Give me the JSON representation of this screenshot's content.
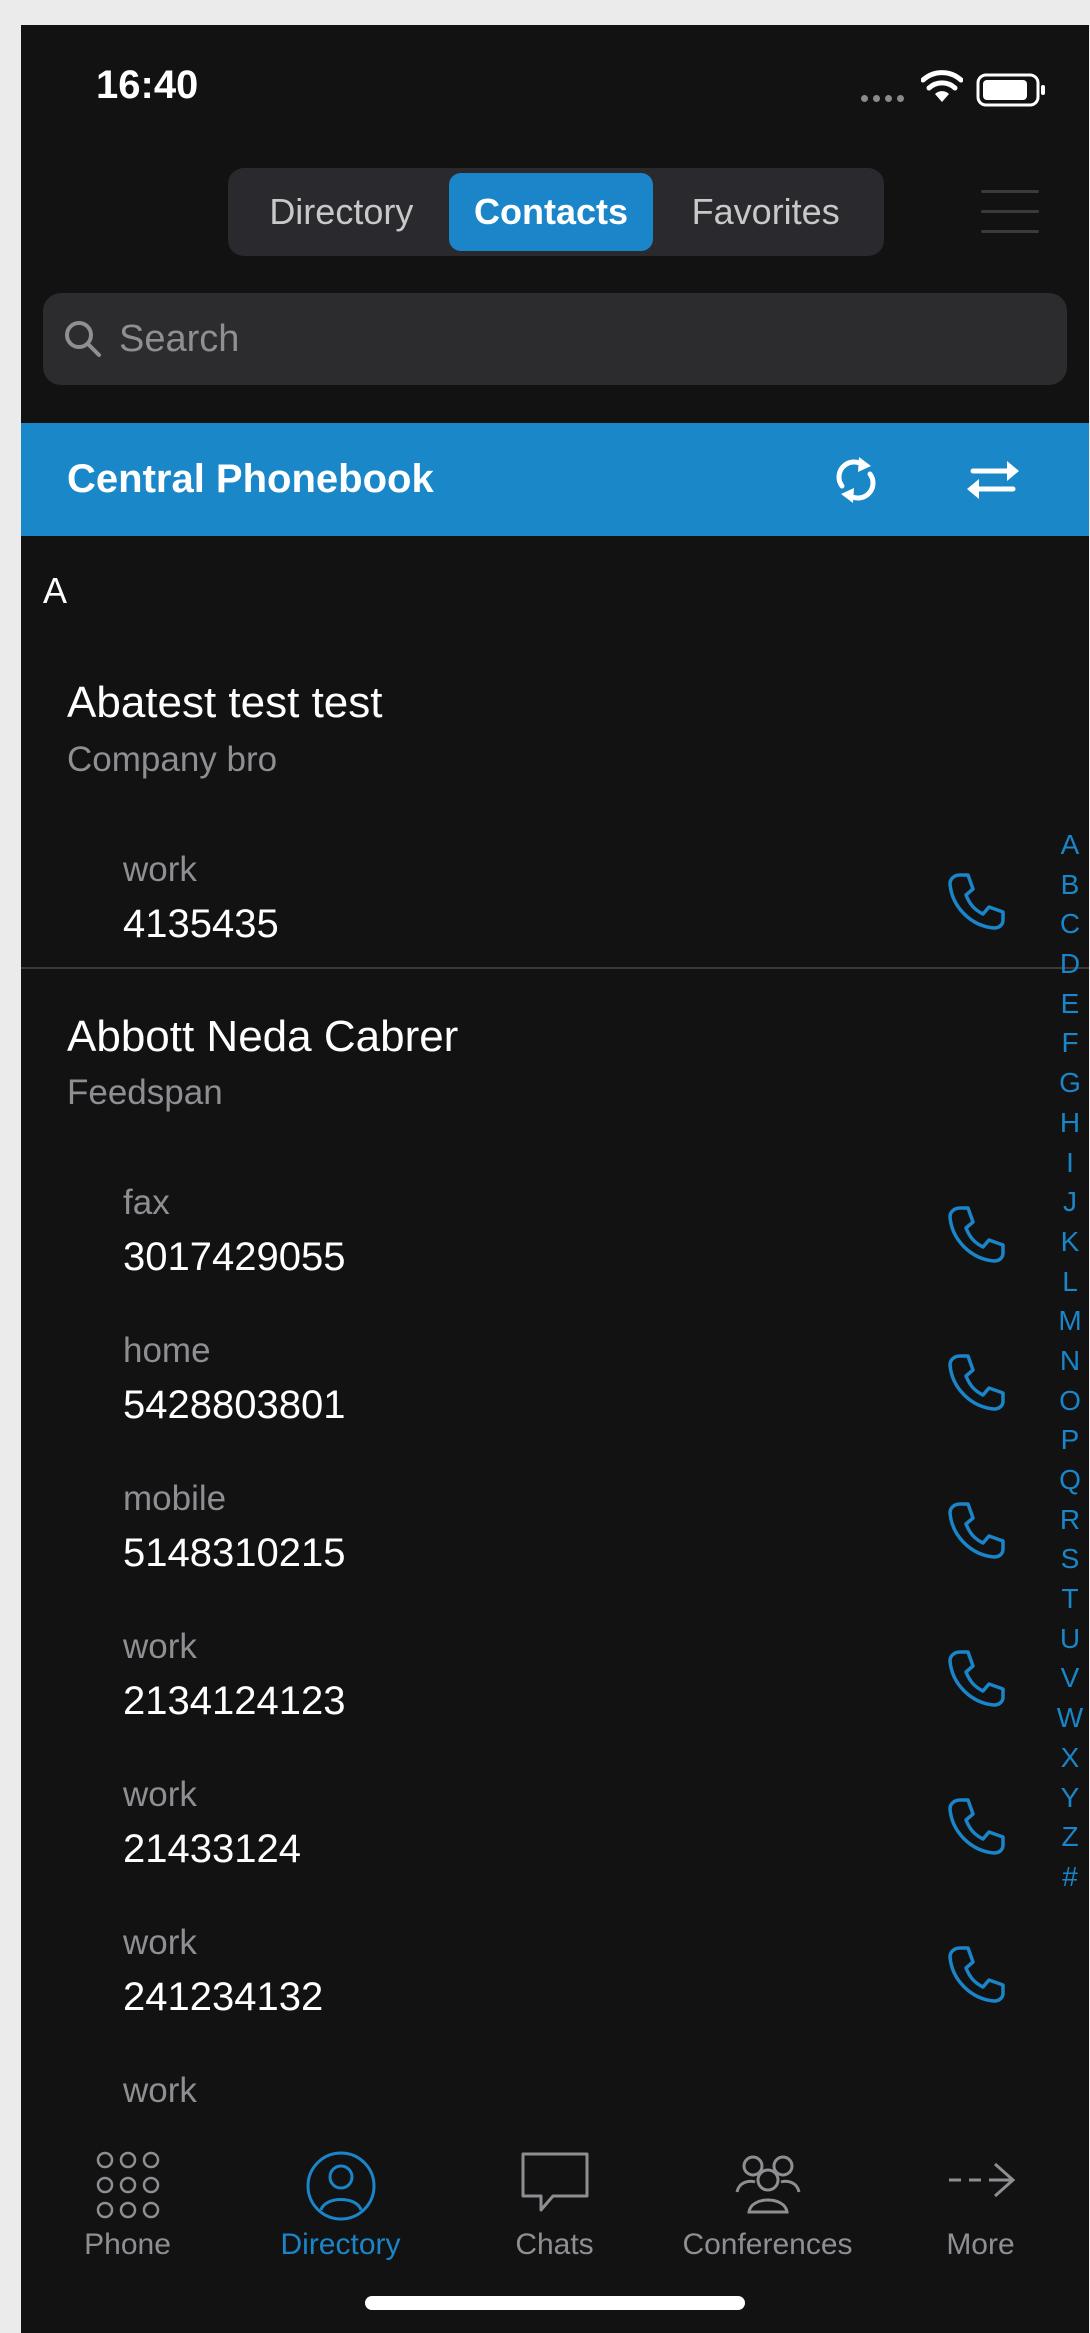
{
  "status_bar": {
    "time": "16:40"
  },
  "segments": {
    "directory": "Directory",
    "contacts": "Contacts",
    "favorites": "Favorites"
  },
  "search": {
    "placeholder": "Search"
  },
  "phonebook_header": {
    "title": "Central Phonebook"
  },
  "section": {
    "letter": "A"
  },
  "contacts": [
    {
      "name": "Abatest test test",
      "company": "Company bro",
      "numbers": [
        {
          "type": "work",
          "number": "4135435"
        }
      ]
    },
    {
      "name": "Abbott Neda Cabrer",
      "company": "Feedspan",
      "numbers": [
        {
          "type": "fax",
          "number": "3017429055"
        },
        {
          "type": "home",
          "number": "5428803801"
        },
        {
          "type": "mobile",
          "number": "5148310215"
        },
        {
          "type": "work",
          "number": "2134124123"
        },
        {
          "type": "work",
          "number": "21433124"
        },
        {
          "type": "work",
          "number": "241234132"
        },
        {
          "type": "work",
          "number": ""
        }
      ]
    }
  ],
  "index_letters": [
    "A",
    "B",
    "C",
    "D",
    "E",
    "F",
    "G",
    "H",
    "I",
    "J",
    "K",
    "L",
    "M",
    "N",
    "O",
    "P",
    "Q",
    "R",
    "S",
    "T",
    "U",
    "V",
    "W",
    "X",
    "Y",
    "Z",
    "#"
  ],
  "tabs": {
    "phone": "Phone",
    "directory": "Directory",
    "chats": "Chats",
    "conferences": "Conferences",
    "more": "More"
  },
  "colors": {
    "accent": "#1a85c8",
    "background": "#121212",
    "header_bar": "#1a87c9"
  },
  "icons": {
    "status": [
      "cellular-signal-icon",
      "wifi-icon",
      "battery-icon"
    ],
    "header": [
      "sync-icon",
      "swap-icon"
    ],
    "rows": "phone-call-icon",
    "tabs": [
      "dialpad-icon",
      "person-icon",
      "chat-bubble-icon",
      "group-icon",
      "arrow-right-icon"
    ]
  }
}
